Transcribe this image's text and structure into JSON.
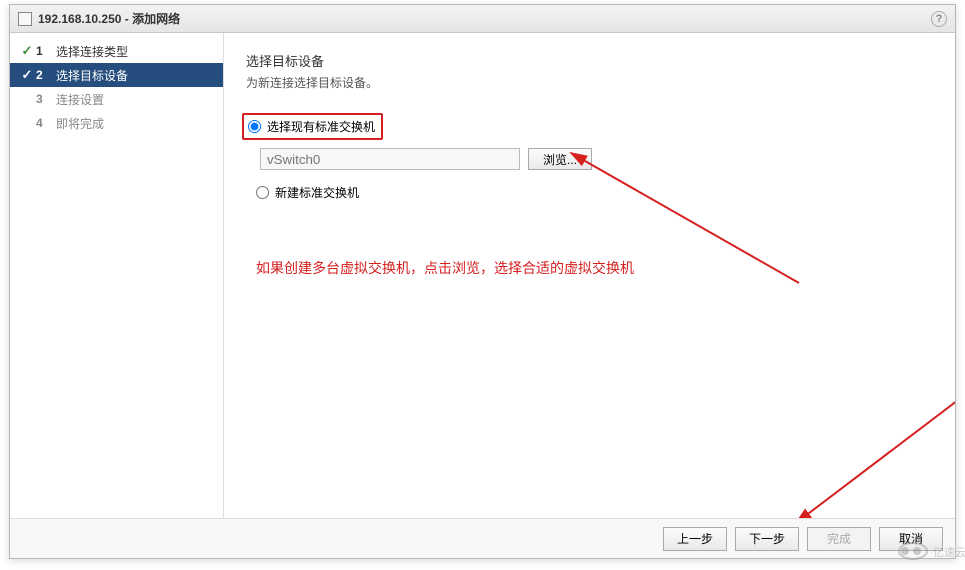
{
  "window": {
    "title": "192.168.10.250 - 添加网络",
    "help_tooltip": "?"
  },
  "sidebar": {
    "steps": [
      {
        "num": "1",
        "label": "选择连接类型",
        "done": true,
        "active": false
      },
      {
        "num": "2",
        "label": "选择目标设备",
        "done": true,
        "active": true
      },
      {
        "num": "3",
        "label": "连接设置",
        "done": false,
        "active": false
      },
      {
        "num": "4",
        "label": "即将完成",
        "done": false,
        "active": false
      }
    ]
  },
  "content": {
    "title": "选择目标设备",
    "subtitle": "为新连接选择目标设备。",
    "option_existing": "选择现有标准交换机",
    "switch_placeholder": "vSwitch0",
    "browse_button": "浏览...",
    "option_new": "新建标准交换机",
    "annotation": "如果创建多台虚拟交换机，点击浏览，选择合适的虚拟交换机"
  },
  "footer": {
    "back": "上一步",
    "next": "下一步",
    "finish": "完成",
    "cancel": "取消"
  },
  "watermark": "亿速云"
}
